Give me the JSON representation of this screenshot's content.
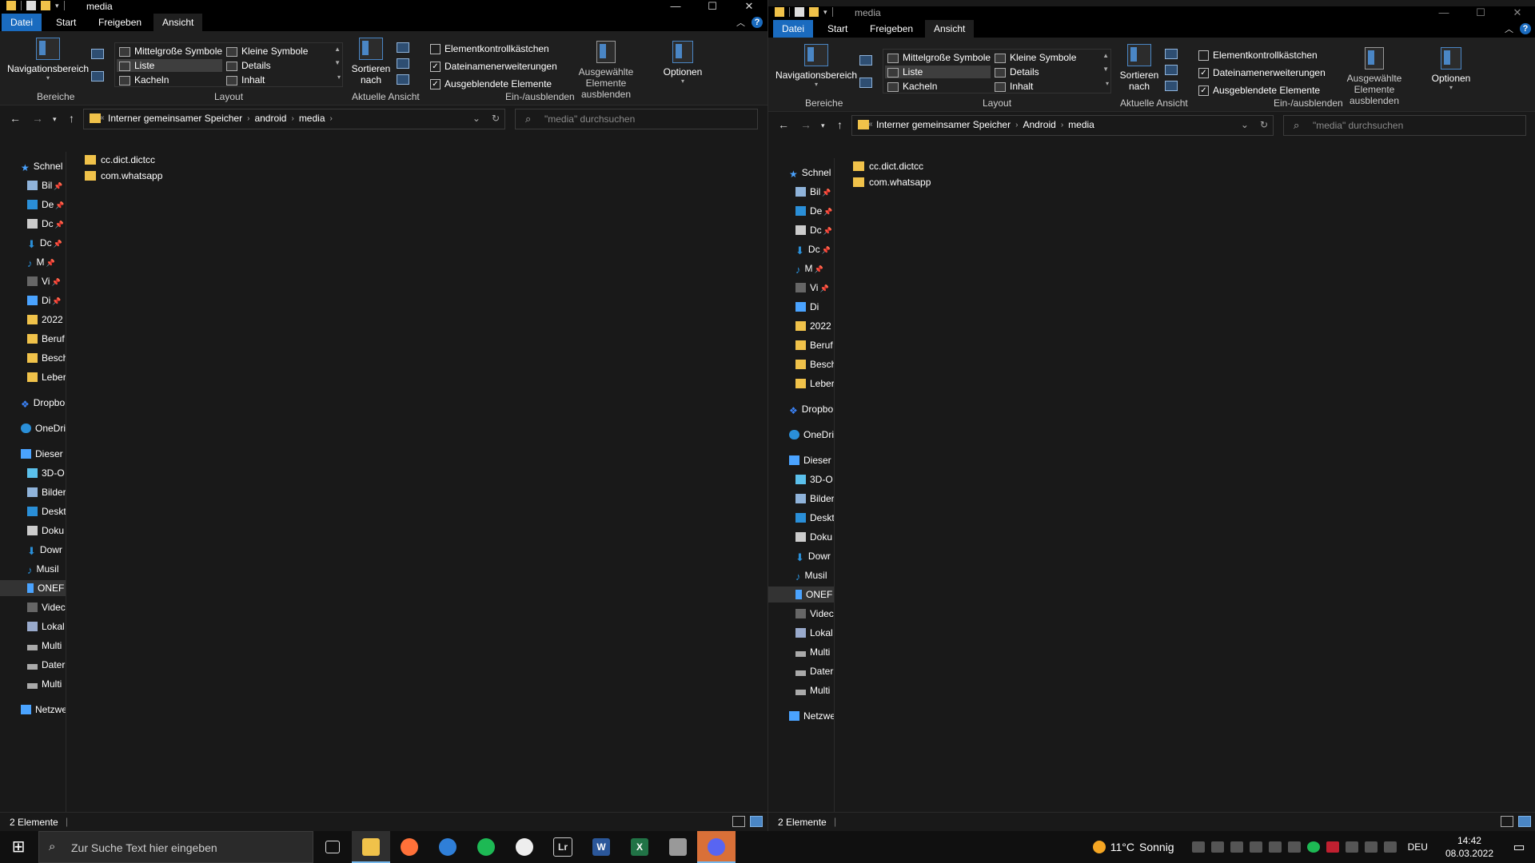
{
  "left_window": {
    "title": "media",
    "tabs": [
      "Datei",
      "Start",
      "Freigeben",
      "Ansicht"
    ],
    "ribbon": {
      "nav_pane": "Navigationsbereich",
      "group_bereiche": "Bereiche",
      "layout_items": [
        "Mittelgroße Symbole",
        "Kleine Symbole",
        "Liste",
        "Details",
        "Kacheln",
        "Inhalt"
      ],
      "group_layout": "Layout",
      "sort_line1": "Sortieren",
      "sort_line2": "nach",
      "group_view": "Aktuelle Ansicht",
      "checkboxes": [
        {
          "label": "Elementkontrollkästchen",
          "checked": "false"
        },
        {
          "label": "Dateinamenerweiterungen",
          "checked": "true"
        },
        {
          "label": "Ausgeblendete Elemente",
          "checked": "true"
        }
      ],
      "hide_selected_line1": "Ausgewählte",
      "hide_selected_line2": "Elemente ausblenden",
      "group_showhide": "Ein-/ausblenden",
      "options": "Optionen"
    },
    "breadcrumb": [
      "Interner gemeinsamer Speicher",
      "android",
      "media"
    ],
    "search_placeholder": "\"media\" durchsuchen",
    "sidebar": [
      "Schnel",
      "Bil",
      "De",
      "Dc",
      "Dc",
      "M",
      "Vi",
      "Di",
      "2022",
      "Beruf",
      "Besch",
      "Leber",
      "Dropbo",
      "OneDri",
      "Dieser",
      "3D-O",
      "Bilder",
      "Deskt",
      "Doku",
      "Dowr",
      "Musil",
      "ONEF",
      "Videc",
      "Lokal",
      "Multi",
      "Dater",
      "Multi",
      "Netzwe"
    ],
    "files": [
      "cc.dict.dictcc",
      "com.whatsapp"
    ],
    "status": "2 Elemente"
  },
  "right_window": {
    "title": "media",
    "tabs": [
      "Datei",
      "Start",
      "Freigeben",
      "Ansicht"
    ],
    "ribbon": {
      "nav_pane": "Navigationsbereich",
      "group_bereiche": "Bereiche",
      "layout_items": [
        "Mittelgroße Symbole",
        "Kleine Symbole",
        "Liste",
        "Details",
        "Kacheln",
        "Inhalt"
      ],
      "group_layout": "Layout",
      "sort_line1": "Sortieren",
      "sort_line2": "nach",
      "group_view": "Aktuelle Ansicht",
      "checkboxes": [
        {
          "label": "Elementkontrollkästchen",
          "checked": "false"
        },
        {
          "label": "Dateinamenerweiterungen",
          "checked": "true"
        },
        {
          "label": "Ausgeblendete Elemente",
          "checked": "true"
        }
      ],
      "hide_selected_line1": "Ausgewählte",
      "hide_selected_line2": "Elemente ausblenden",
      "group_showhide": "Ein-/ausblenden",
      "options": "Optionen"
    },
    "breadcrumb": [
      "Interner gemeinsamer Speicher",
      "Android",
      "media"
    ],
    "search_placeholder": "\"media\" durchsuchen",
    "sidebar": [
      "Schnel",
      "Bil",
      "De",
      "Dc",
      "Dc",
      "M",
      "Vi",
      "Di",
      "2022",
      "Beruf",
      "Besch",
      "Leber",
      "Dropbo",
      "OneDri",
      "Dieser",
      "3D-O",
      "Bilder",
      "Deskt",
      "Doku",
      "Dowr",
      "Musil",
      "ONEF",
      "Videc",
      "Lokal",
      "Multi",
      "Dater",
      "Multi",
      "Netzwe"
    ],
    "files": [
      "cc.dict.dictcc",
      "com.whatsapp"
    ],
    "status": "2 Elemente"
  },
  "taskbar": {
    "search_placeholder": "Zur Suche Text hier eingeben",
    "apps": [
      "task-view",
      "file-explorer",
      "firefox",
      "outlook",
      "spotify",
      "panda",
      "lightroom",
      "word",
      "excel",
      "remote",
      "discord"
    ],
    "app_labels": [
      "",
      "",
      "",
      "",
      "",
      "",
      "Lr",
      "W",
      "X",
      "",
      ""
    ],
    "temperature": "11°C",
    "weather": "Sonnig",
    "language": "DEU",
    "time": "14:42",
    "date": "08.03.2022"
  },
  "colors": {
    "accent": "#1a6bbf",
    "folder": "#f0c24a",
    "background": "#191919"
  }
}
